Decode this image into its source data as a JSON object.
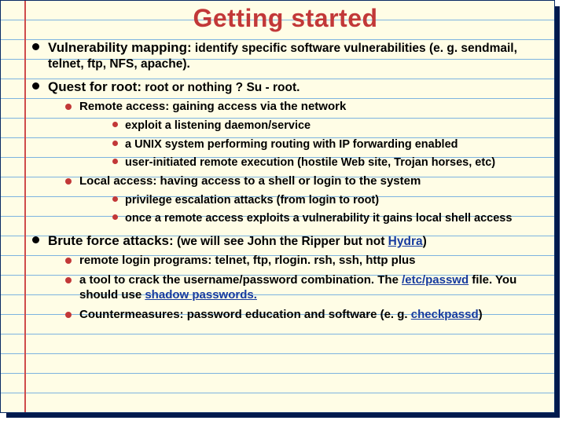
{
  "title": "Getting started",
  "bullets": {
    "b1_lead": "Vulnerability mapping:",
    "b1_rest": " identify specific software vulnerabilities (e. g. sendmail, telnet, ftp, NFS, apache).",
    "b2_lead": "Quest for root:",
    "b2_rest": " root or nothing ? Su - root.",
    "b2_1": "Remote access: gaining access via the network",
    "b2_1_1": "exploit a listening daemon/service",
    "b2_1_2": "a UNIX system performing routing with IP forwarding enabled",
    "b2_1_3": "user-initiated remote execution (hostile Web site, Trojan horses, etc)",
    "b2_2": "Local access: having access to a shell or login to the system",
    "b2_2_1": "privilege escalation attacks (from login to root)",
    "b2_2_2": "once a remote access exploits a vulnerability it gains local shell access",
    "b3_lead": "Brute force attacks:",
    "b3_rest_a": " (we will see John the Ripper but not ",
    "b3_link1": "Hydra",
    "b3_rest_b": ")",
    "b3_1": " remote login programs: telnet, ftp, rlogin. rsh, ssh, http  plus",
    "b3_2_a": " a tool to crack the username/password combination. The ",
    "b3_2_link": "/etc/passwd",
    "b3_2_b": " file. You should use ",
    "b3_2_link2": "shadow passwords.",
    "b3_3_a": "Countermeasures:  password education and software (e. g. ",
    "b3_3_link": "checkpassd",
    "b3_3_b": ")"
  }
}
